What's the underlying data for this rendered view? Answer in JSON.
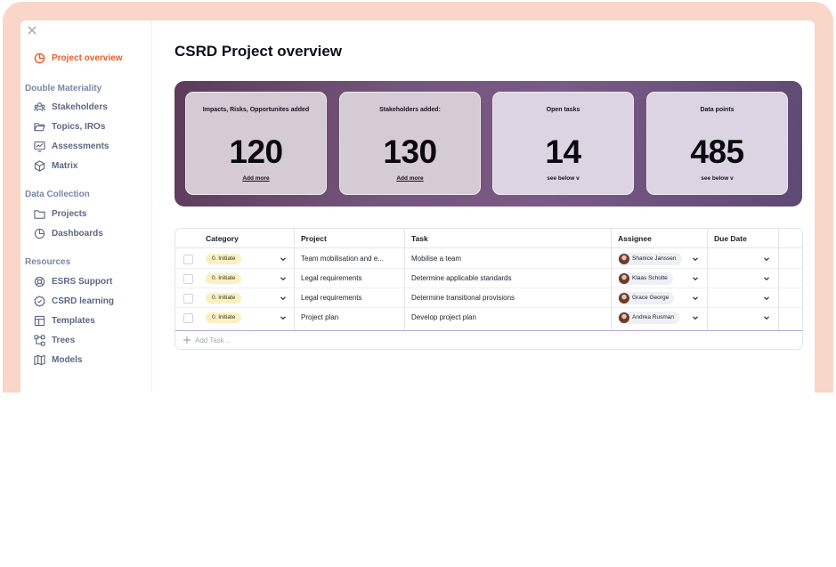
{
  "sidebar": {
    "active_item": "Project overview",
    "sections": [
      {
        "title": "Double Materiality",
        "items": [
          "Stakeholders",
          "Topics, IROs",
          "Assessments",
          "Matrix"
        ]
      },
      {
        "title": "Data Collection",
        "items": [
          "Projects",
          "Dashboards"
        ]
      },
      {
        "title": "Resources",
        "items": [
          "ESRS Support",
          "CSRD learning",
          "Templates",
          "Trees",
          "Models"
        ]
      }
    ]
  },
  "page": {
    "title": "CSRD Project overview"
  },
  "stats": [
    {
      "label": "Impacts, Risks, Opportunites added",
      "value": "120",
      "link": "Add more"
    },
    {
      "label": "Stakeholders added:",
      "value": "130",
      "link": "Add more"
    },
    {
      "label": "Open tasks",
      "value": "14",
      "link": "see below v"
    },
    {
      "label": "Data points",
      "value": "485",
      "link": "see below v"
    }
  ],
  "table": {
    "columns": [
      "Category",
      "Project",
      "Task",
      "Assignee",
      "Due Date"
    ],
    "rows": [
      {
        "category": "0. Initiate",
        "project": "Team mobilisation and e...",
        "task": "Mobilise a team",
        "assignee": "Shanice Janssen"
      },
      {
        "category": "0. Initiate",
        "project": "Legal requirements",
        "task": "Determine applicable standards",
        "assignee": "Klaas Scholte"
      },
      {
        "category": "0. Initiate",
        "project": "Legal requirements",
        "task": "Determine transitional provisions",
        "assignee": "Grace George"
      },
      {
        "category": "0. Initiate",
        "project": "Project plan",
        "task": "Develop project plan",
        "assignee": "Andrea Rusman"
      }
    ],
    "add_task": "Add Task .."
  },
  "colors": {
    "accent": "#f05a22",
    "frame": "#f9d6c8",
    "category_pill": "#fbf0c4"
  }
}
